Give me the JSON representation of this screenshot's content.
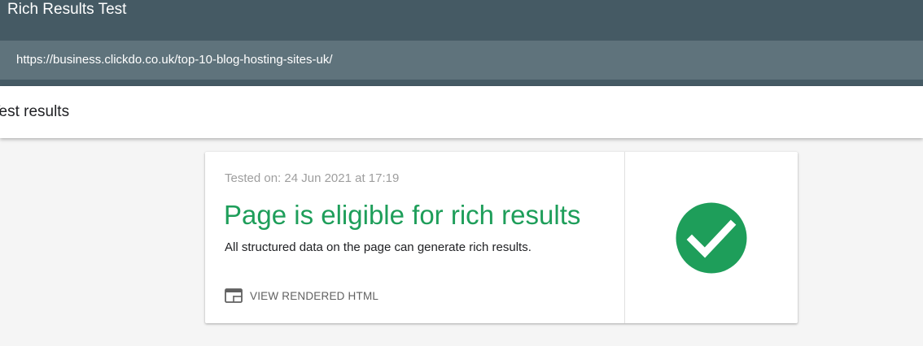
{
  "header": {
    "title": "Rich Results Test",
    "url": "https://business.clickdo.co.uk/top-10-blog-hosting-sites-uk/",
    "background_color": "#455a64",
    "url_bar_color": "#5f737c"
  },
  "toolbar": {
    "title": "Test results"
  },
  "result_card": {
    "tested_on": "Tested on: 24 Jun 2021 at 17:19",
    "status_title": "Page is eligible for rich results",
    "status_description": "All structured data on the page can generate rich results.",
    "view_rendered_html_label": "VIEW RENDERED HTML",
    "view_rendered_html_icon": "browser-window-icon",
    "status_icon": "check-circle-icon",
    "status_color": "#1e9e5a"
  }
}
